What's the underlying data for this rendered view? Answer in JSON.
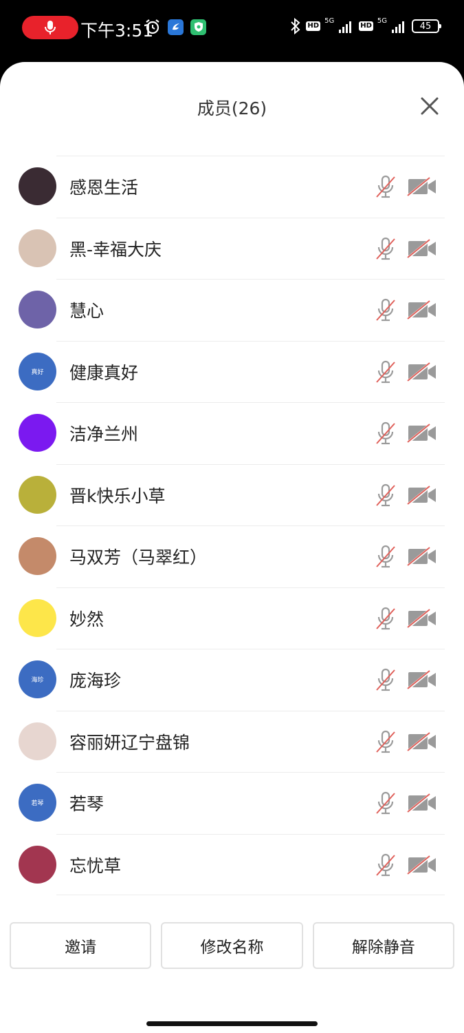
{
  "status_bar": {
    "time": "下午3:51",
    "network_1": "5G",
    "network_2": "5G",
    "hd_1": "HD",
    "hd_2": "HD",
    "battery": "45"
  },
  "sheet": {
    "title": "成员(26)"
  },
  "members": [
    {
      "name": "感恩生活",
      "avatar_text": "",
      "avatar_color": "#3a2b33",
      "mic_muted": true,
      "camera_off": true
    },
    {
      "name": "黑-幸福大庆",
      "avatar_text": "",
      "avatar_color": "#d9c3b4",
      "mic_muted": true,
      "camera_off": true
    },
    {
      "name": "慧心",
      "avatar_text": "",
      "avatar_color": "#6e63a8",
      "mic_muted": true,
      "camera_off": true
    },
    {
      "name": "健康真好",
      "avatar_text": "真好",
      "avatar_color": "#3c6cc2",
      "mic_muted": true,
      "camera_off": true
    },
    {
      "name": "洁净兰州",
      "avatar_text": "",
      "avatar_color": "#7b19f0",
      "mic_muted": true,
      "camera_off": true
    },
    {
      "name": "晋k快乐小草",
      "avatar_text": "",
      "avatar_color": "#b9b03a",
      "mic_muted": true,
      "camera_off": true
    },
    {
      "name": "马双芳（马翠红）",
      "avatar_text": "",
      "avatar_color": "#c48a6a",
      "mic_muted": true,
      "camera_off": true
    },
    {
      "name": "妙然",
      "avatar_text": "",
      "avatar_color": "#fde64a",
      "mic_muted": true,
      "camera_off": true
    },
    {
      "name": "庞海珍",
      "avatar_text": "海珍",
      "avatar_color": "#3c6cc2",
      "mic_muted": true,
      "camera_off": true
    },
    {
      "name": "容丽妍辽宁盘锦",
      "avatar_text": "",
      "avatar_color": "#e7d6d0",
      "mic_muted": true,
      "camera_off": true
    },
    {
      "name": "若琴",
      "avatar_text": "若琴",
      "avatar_color": "#3c6cc2",
      "mic_muted": true,
      "camera_off": true
    },
    {
      "name": "忘忧草",
      "avatar_text": "",
      "avatar_color": "#a23650",
      "mic_muted": true,
      "camera_off": true
    }
  ],
  "actions": {
    "invite": "邀请",
    "rename": "修改名称",
    "unmute": "解除静音"
  },
  "colors": {
    "accent_red": "#e8222b",
    "icon_gray": "#9a9a9a",
    "slash_red": "#e0605a",
    "avatar_blue": "#3c6cc2"
  }
}
